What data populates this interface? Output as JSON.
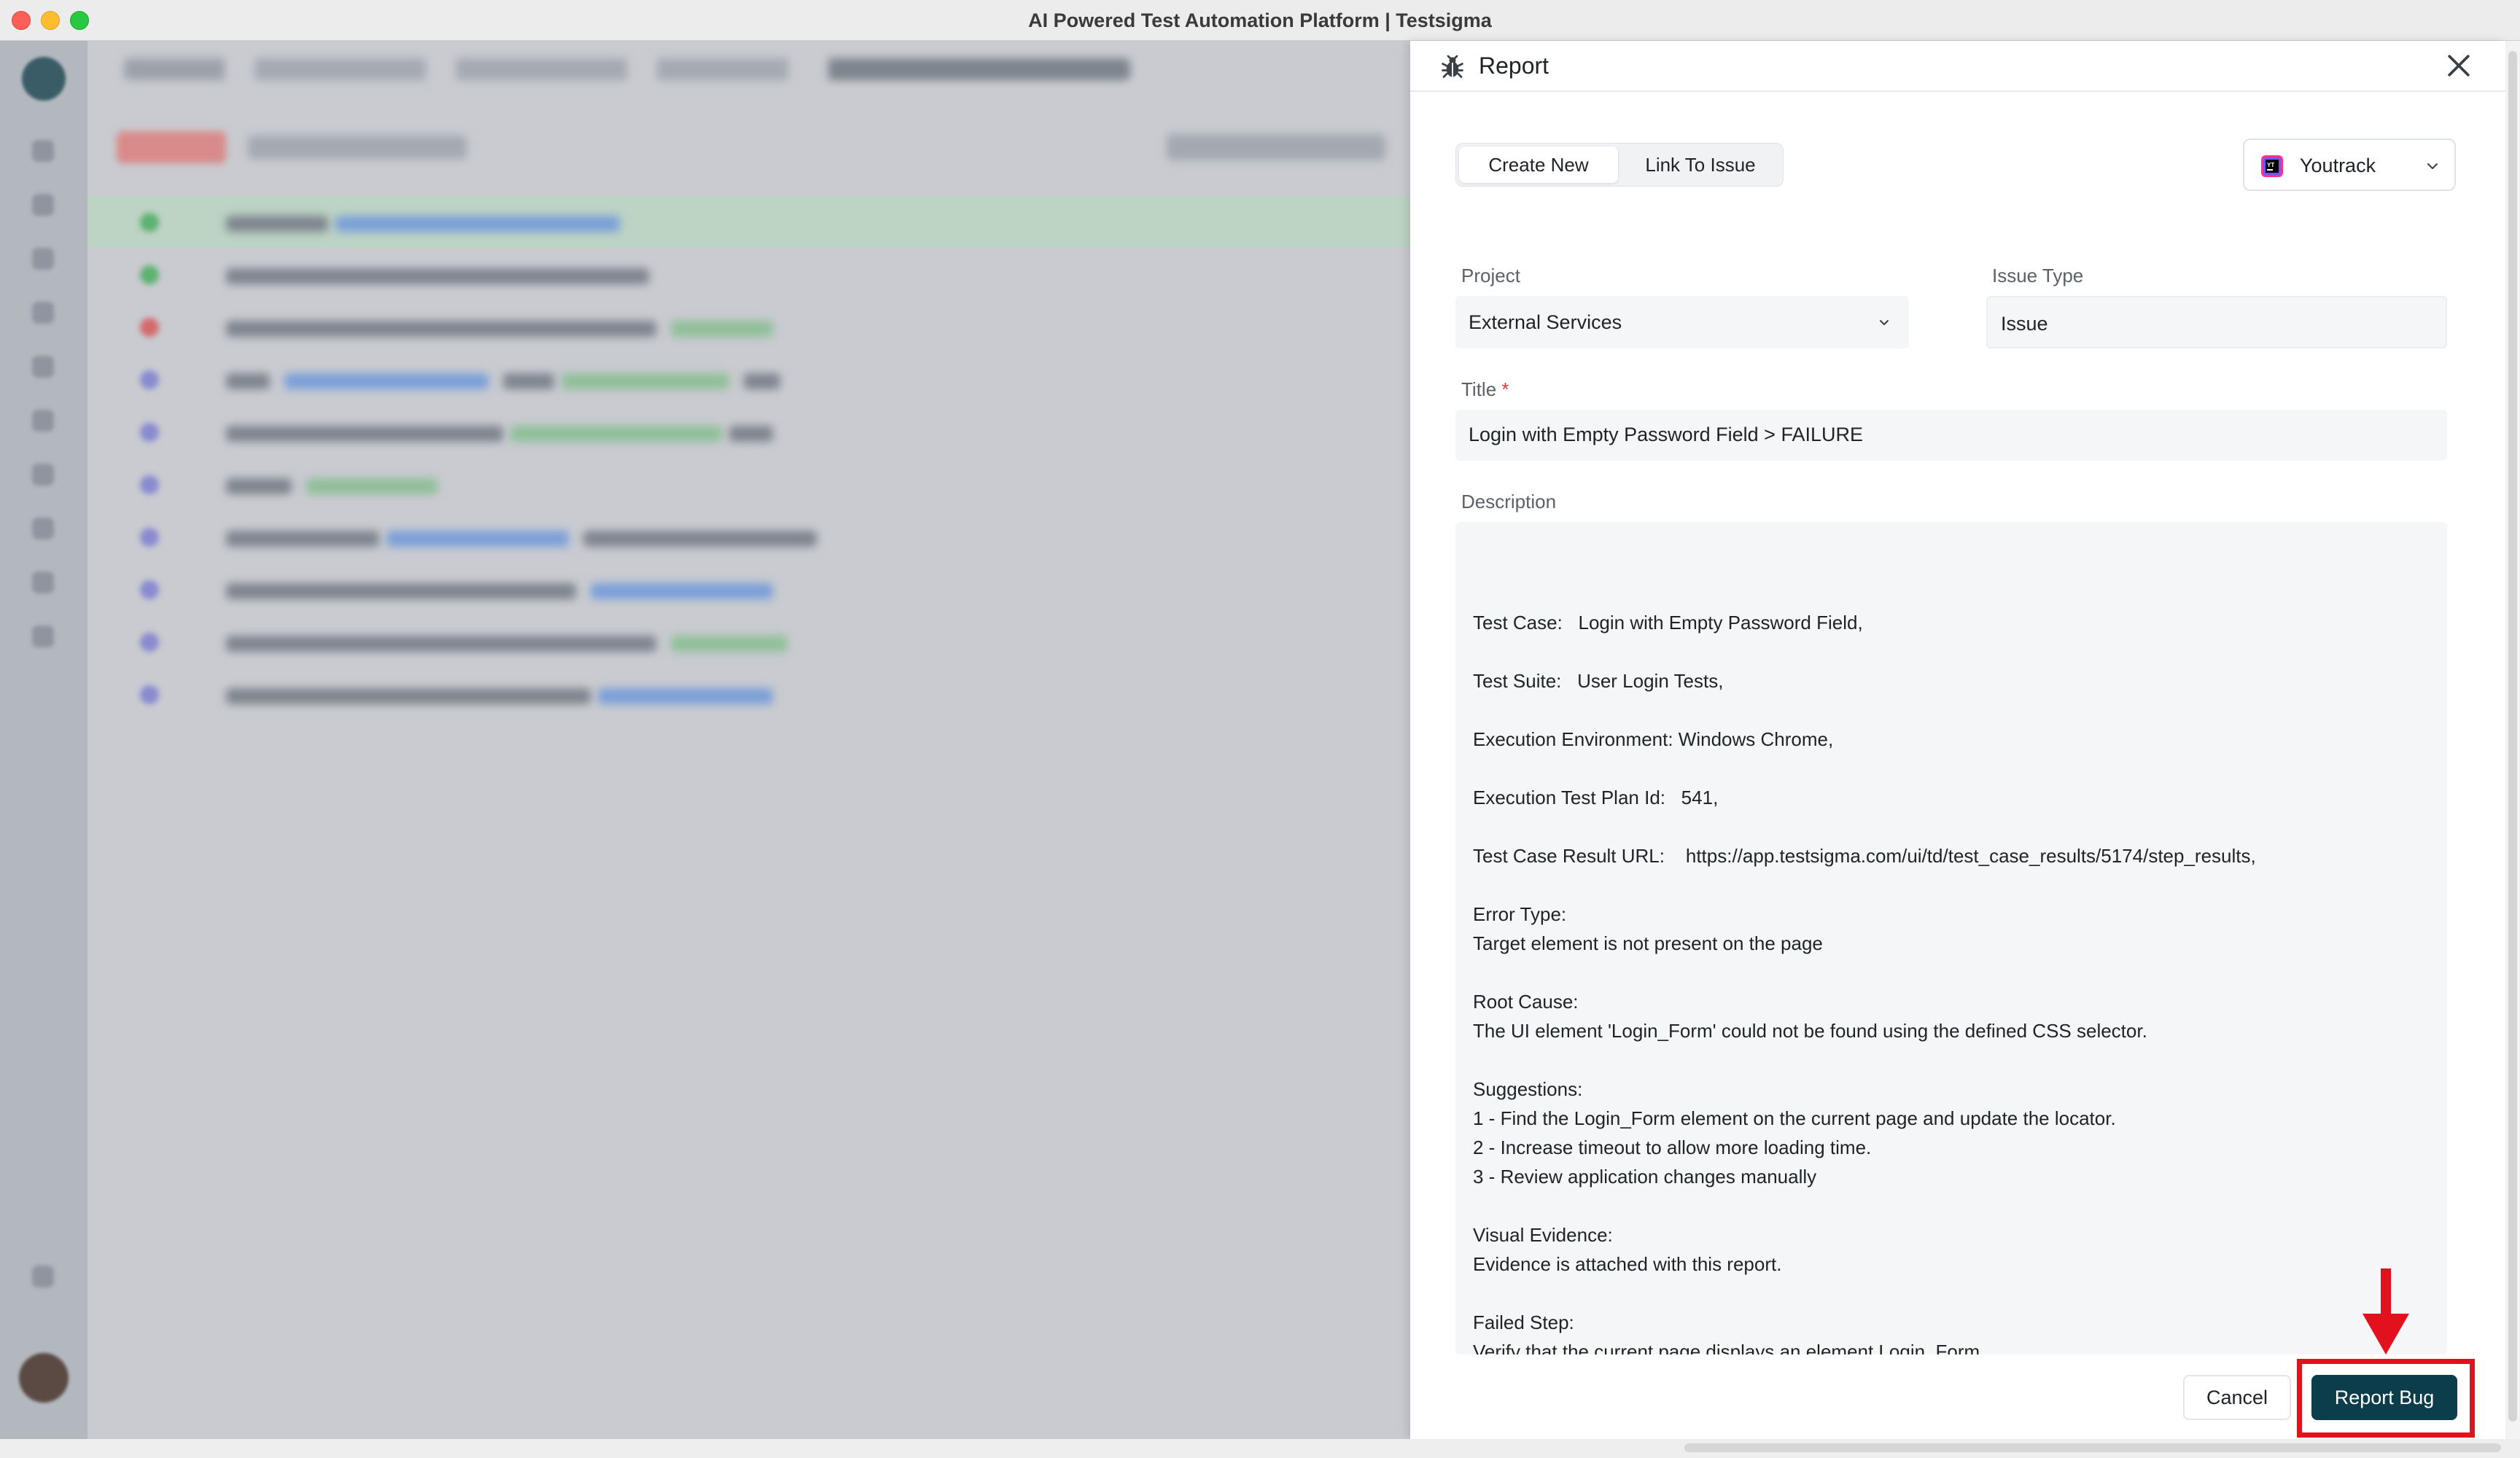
{
  "window": {
    "title": "AI Powered Test Automation Platform | Testsigma"
  },
  "panel": {
    "title": "Report",
    "tabs": [
      {
        "label": "Create New",
        "active": true
      },
      {
        "label": "Link To Issue",
        "active": false
      }
    ],
    "tracker": {
      "selected": "Youtrack",
      "icon": "youtrack-logo"
    },
    "project": {
      "label": "Project",
      "value": "External Services"
    },
    "issue_type": {
      "label": "Issue Type",
      "value": "Issue"
    },
    "title_field": {
      "label": "Title",
      "required_mark": "*",
      "value": "Login with Empty Password Field > FAILURE"
    },
    "description": {
      "label": "Description",
      "lines": [
        "Test Case:   Login with Empty Password Field,",
        "",
        "Test Suite:   User Login Tests,",
        "",
        "Execution Environment: Windows Chrome,",
        "",
        "Execution Test Plan Id:   541,",
        "",
        "Test Case Result URL:    https://app.testsigma.com/ui/td/test_case_results/5174/step_results,",
        "",
        "Error Type:",
        "Target element is not present on the page",
        "",
        "Root Cause:",
        "The UI element 'Login_Form' could not be found using the defined CSS selector.",
        "",
        "Suggestions:",
        "1 - Find the Login_Form element on the current page and update the locator.",
        "2 - Increase timeout to allow more loading time.",
        "3 - Review application changes manually",
        "",
        "Visual Evidence:",
        "Evidence is attached with this report.",
        "",
        "Failed Step:",
        "Verify that the current page displays an element Login_Form"
      ]
    },
    "actions": {
      "cancel": "Cancel",
      "report": "Report Bug"
    }
  },
  "colors": {
    "primary": "#0b3d4a",
    "annotation": "#e3101d",
    "required": "#d63b3b"
  }
}
